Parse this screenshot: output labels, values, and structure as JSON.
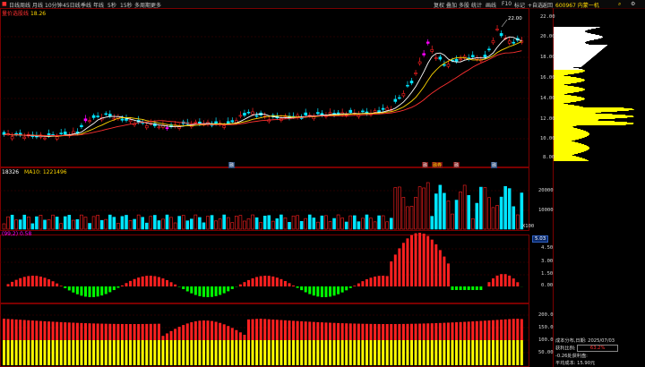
{
  "toolbar": {
    "left_items": [
      "日线",
      "周线",
      "月线",
      "10分钟",
      "45日线",
      "季线",
      "年线",
      "5秒",
      "15秒",
      "多周期",
      "更多"
    ],
    "right_items": [
      "复权",
      "叠加",
      "多股",
      "统计",
      "画线",
      "F10",
      "标记",
      "+自选",
      "返回"
    ],
    "stock_code_name": "600967 内蒙一机"
  },
  "main_panel": {
    "indicator_label": "量价选股线",
    "indicator_value": "18.26",
    "peak_label": "22.00",
    "price_axis": [
      "22.00",
      "20.00",
      "18.00",
      "16.00",
      "14.00",
      "12.00",
      "10.00",
      "8.00"
    ]
  },
  "volume_panel": {
    "label_vol": "18326",
    "label_ma": "MA10: 1221496",
    "unit": "X100",
    "axis": [
      "20000",
      "10000"
    ]
  },
  "macd_panel": {
    "label": "(99,2) 0.58",
    "value_box": "5.03",
    "axis": [
      "4.50",
      "3.00",
      "1.50",
      "0.00"
    ]
  },
  "chip_panel": {
    "axis": [
      "200.0",
      "150.0",
      "100.0",
      "50.00"
    ]
  },
  "info_panel": {
    "line1": "成本分布,日期: 2025/07/03",
    "profit_label": "获利比例:",
    "profit_value": "63.2%",
    "line3": "-0.26处获利盘:",
    "line4": "平均成本: 15.90元"
  },
  "markers": [
    "融",
    "融",
    "融券",
    "融",
    "融"
  ],
  "colors": {
    "up": "#ff2020",
    "down": "#00e5ff",
    "ma1": "#ffffff",
    "ma2": "#ffd700",
    "ma3": "#ff3030",
    "magenta": "#ff00ff",
    "green": "#00ff00",
    "yellow": "#ffff00"
  }
}
